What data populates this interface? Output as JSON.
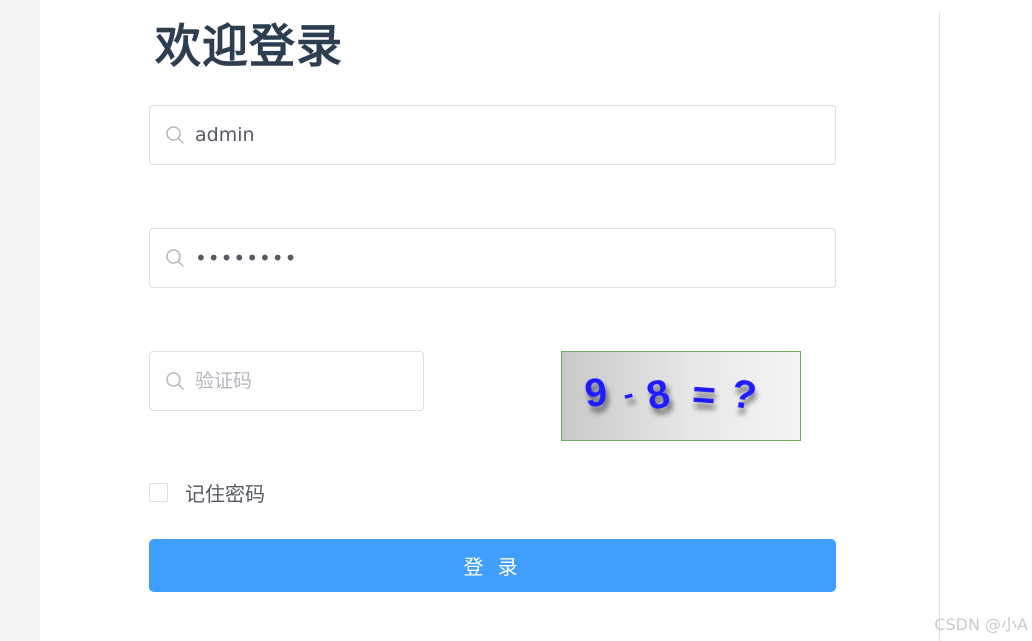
{
  "title": "欢迎登录",
  "username": {
    "value": "admin",
    "icon": "search-icon"
  },
  "password": {
    "value": "••••••••",
    "icon": "search-icon"
  },
  "captcha": {
    "placeholder": "验证码",
    "icon": "search-icon",
    "image_text": "9-8=?"
  },
  "remember": {
    "label": "记住密码",
    "checked": false
  },
  "login_button": {
    "label": "登 录"
  },
  "watermark": "CSDN @小A",
  "colors": {
    "primary": "#409eff",
    "title": "#2c3e50",
    "border": "#dcdfe6",
    "captcha_text": "#1a1aff"
  }
}
